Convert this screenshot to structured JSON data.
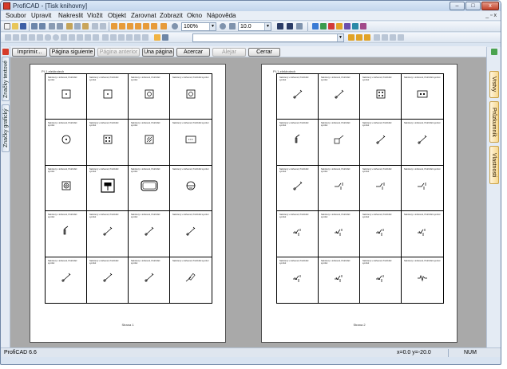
{
  "window": {
    "title": "ProfiCAD - [Tisk knihovny]",
    "minimize": "–",
    "maximize": "□",
    "close": "x"
  },
  "menu": [
    "Soubor",
    "Upravit",
    "Nakreslit",
    "Vložit",
    "Objekt",
    "Zarovnat",
    "Zobrazit",
    "Okno",
    "Nápověda"
  ],
  "mdi_controls": "_ ▫ x",
  "toolbar": {
    "zoom": "100%",
    "line_width": "10.0",
    "font_combo": ""
  },
  "preview_buttons": [
    "Imprimir...",
    "Página siguiente",
    "Página anterior",
    "Una página",
    "Acercar",
    "Alejar",
    "Cerrar"
  ],
  "preview_disabled": [
    false,
    false,
    true,
    false,
    false,
    true,
    false
  ],
  "left_tabs": [
    "Značky textové",
    "Značky grafický"
  ],
  "right_tabs": [
    "Vrstvy",
    "Průzkumník",
    "Vlastnosti"
  ],
  "pages": [
    {
      "header": "PI-1-elektrotech",
      "footer": "Strana 1",
      "symbols": [
        "square-dot",
        "square-dot",
        "square-circle",
        "square-circle",
        "circle-dot",
        "square-four",
        "square-hatch",
        "square-dash",
        "square-target",
        "square-switch",
        "rounded-rect",
        "circle-cross",
        "vline",
        "diag-switch",
        "diag-switch",
        "diag-switch",
        "diag-switch",
        "diag-switch",
        "diag-switch",
        "diag-knife"
      ]
    },
    {
      "header": "PI-1-elektrotech",
      "footer": "Strana 2",
      "symbols": [
        "diag-switch",
        "diag-switch",
        "square-four",
        "square-two",
        "vline",
        "square-diag",
        "diag-switch",
        "diag-switch",
        "diag-switch",
        "hook",
        "hook",
        "hook",
        "relay",
        "relay",
        "relay",
        "relay",
        "relay",
        "relay",
        "relay",
        "wave"
      ]
    }
  ],
  "caption": "Nabízený v knihovně, ProfiCAD symbol",
  "status": {
    "app": "ProfiCAD 6.6",
    "coords": "x=0.0  y=-20.0",
    "num": "NUM"
  }
}
